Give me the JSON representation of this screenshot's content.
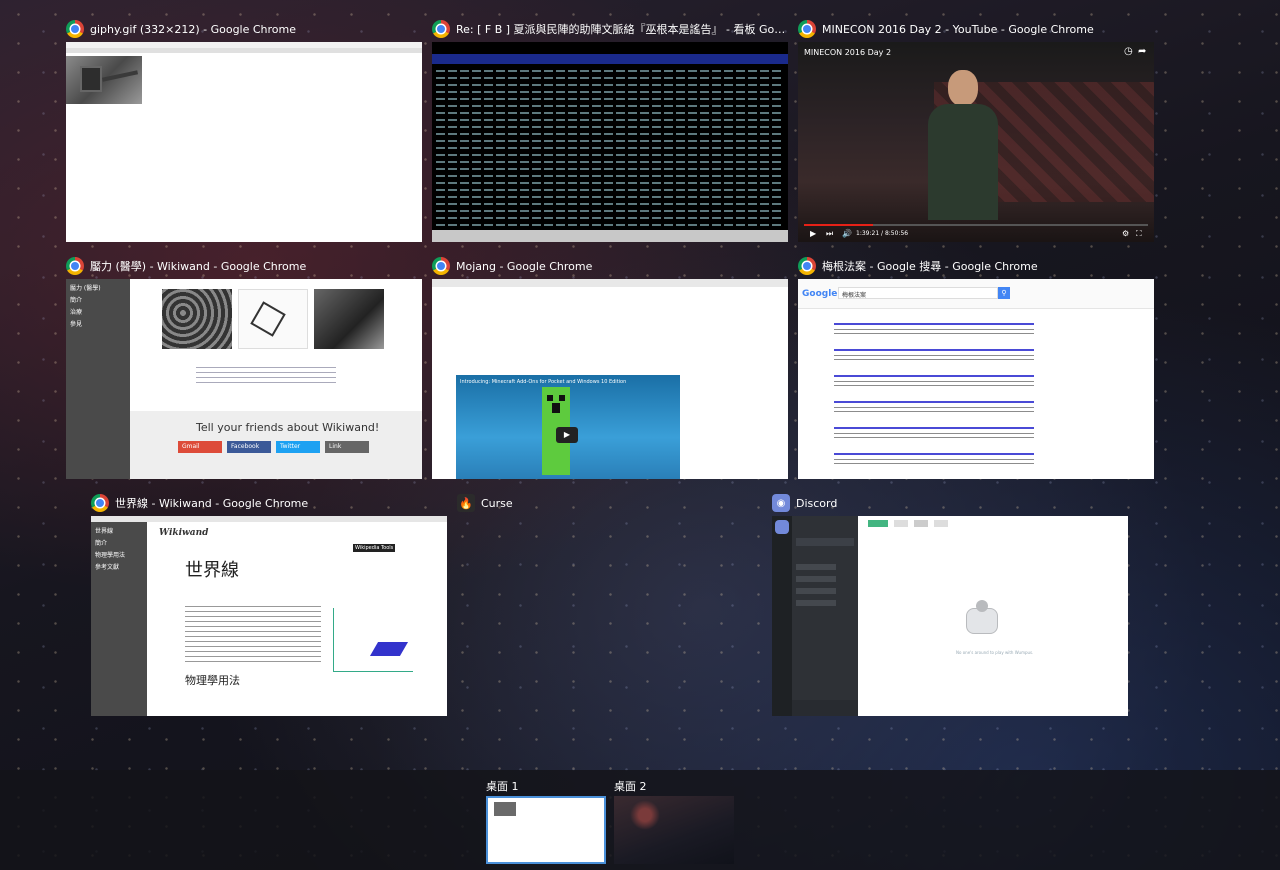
{
  "windows": [
    {
      "title": "giphy.gif (332×212) - Google Chrome",
      "icon": "chrome-icon"
    },
    {
      "title": "Re: [ F B ] 夏派與民陣的助陣文脈絡『巫根本是謠告』 - 看板 Gossipi...",
      "icon": "chrome-icon"
    },
    {
      "title": "MINECON 2016 Day 2 - YouTube - Google Chrome",
      "icon": "chrome-icon"
    },
    {
      "title": "靨力 (醫學) - Wikiwand - Google Chrome",
      "icon": "chrome-icon"
    },
    {
      "title": "Mojang - Google Chrome",
      "icon": "chrome-icon"
    },
    {
      "title": "梅根法案 - Google 搜尋 - Google Chrome",
      "icon": "chrome-icon"
    },
    {
      "title": "世界線 - Wikiwand - Google Chrome",
      "icon": "chrome-icon"
    },
    {
      "title": "Curse",
      "icon": "flame-icon"
    },
    {
      "title": "Discord",
      "icon": "discord-icon"
    }
  ],
  "youtube": {
    "video_title": "MINECON 2016 Day 2",
    "time": "1:39:21 / 8:50:56"
  },
  "wikiwand_stress": {
    "share_heading": "Tell your friends about Wikiwand!",
    "share_buttons": [
      "Gmail",
      "Facebook",
      "Twitter",
      "Link"
    ],
    "sidebar": [
      "靨力 (醫學)",
      "簡介",
      "治療",
      "參見"
    ]
  },
  "mojang": {
    "video_title": "Introducing: Minecraft Add-Ons for Pocket and Windows 10 Edition"
  },
  "google": {
    "logo": "Google",
    "query": "梅根法案"
  },
  "wikiwand_worldline": {
    "logo": "Wikiwand",
    "heading": "世界線",
    "section": "物理學用法",
    "sidebar": [
      "世界線",
      "簡介",
      "物理學用法",
      "參考文獻"
    ],
    "tooltip": "Wikipedia Tools"
  },
  "discord": {
    "empty_text": "No one's around to play with Wumpus."
  },
  "desktops": [
    {
      "label": "桌面 1",
      "active": true
    },
    {
      "label": "桌面 2",
      "active": false
    }
  ],
  "colors": {
    "accent": "#4a90d9",
    "youtube_red": "#e62117",
    "discord_blurple": "#7289da",
    "google_blue": "#4285f4"
  }
}
